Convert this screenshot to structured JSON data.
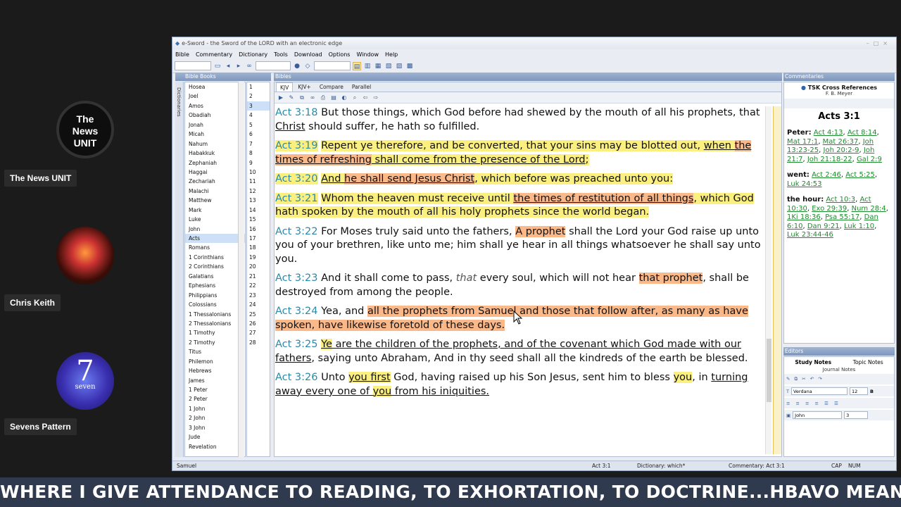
{
  "participants": [
    {
      "name": "The News UNIT",
      "avatar_text": "The\nNews\nUNIT"
    },
    {
      "name": "Chris Keith"
    },
    {
      "name": "Sevens Pattern",
      "avatar_text": "7",
      "avatar_sub": "seven"
    }
  ],
  "window": {
    "title": "e-Sword - the Sword of the LORD with an electronic edge",
    "menu": [
      "Bible",
      "Commentary",
      "Dictionary",
      "Tools",
      "Download",
      "Options",
      "Window",
      "Help"
    ]
  },
  "books_pane": {
    "header": "Bible Books",
    "side_tab": "Dictionaries",
    "books": [
      "Hosea",
      "Joel",
      "Amos",
      "Obadiah",
      "Jonah",
      "Micah",
      "Nahum",
      "Habakkuk",
      "Zephaniah",
      "Haggai",
      "Zechariah",
      "Malachi",
      "Matthew",
      "Mark",
      "Luke",
      "John",
      "Acts",
      "Romans",
      "1 Corinthians",
      "2 Corinthians",
      "Galatians",
      "Ephesians",
      "Philippians",
      "Colossians",
      "1 Thessalonians",
      "2 Thessalonians",
      "1 Timothy",
      "2 Timothy",
      "Titus",
      "Philemon",
      "Hebrews",
      "James",
      "1 Peter",
      "2 Peter",
      "1 John",
      "2 John",
      "3 John",
      "Jude",
      "Revelation"
    ],
    "selected_book": "Acts",
    "chapters": [
      "1",
      "2",
      "3",
      "4",
      "5",
      "6",
      "7",
      "8",
      "9",
      "10",
      "11",
      "12",
      "13",
      "14",
      "15",
      "16",
      "17",
      "18",
      "19",
      "20",
      "21",
      "22",
      "23",
      "24",
      "25",
      "26",
      "27",
      "28"
    ],
    "selected_chapter": "3"
  },
  "bibles_pane": {
    "header": "Bibles",
    "tabs": [
      "KJV",
      "KJV+",
      "Compare",
      "Parallel"
    ],
    "active_tab": "KJV",
    "verses": [
      {
        "ref": "Act 3:18",
        "segments": [
          {
            "t": "But those things, which God before had shewed by the mouth of all his prophets, that "
          },
          {
            "t": "Christ",
            "u": true
          },
          {
            "t": " should suffer, he hath so fulfilled."
          }
        ]
      },
      {
        "ref": "Act 3:19",
        "hl_ref": "y",
        "segments": [
          {
            "t": "Repent ye therefore, and be converted, that your sins may be blotted out, ",
            "h": "y"
          },
          {
            "t": "when ",
            "h": "y",
            "u": true
          },
          {
            "t": "the times of refreshing",
            "h": "o",
            "u": true
          },
          {
            "t": " shall come from the presence of the Lord",
            "h": "y",
            "u": true
          },
          {
            "t": ";",
            "h": "y"
          }
        ]
      },
      {
        "ref": "Act 3:20",
        "hl_ref": "y",
        "segments": [
          {
            "t": "And ",
            "h": "y",
            "u": true
          },
          {
            "t": "he shall send Jesus Christ",
            "h": "o",
            "u": true
          },
          {
            "t": ", which before was preached unto you:",
            "h": "y"
          }
        ]
      },
      {
        "ref": "Act 3:21",
        "hl_ref": "y",
        "segments": [
          {
            "t": "Whom the heaven must receive until ",
            "h": "y"
          },
          {
            "t": "the times of restitution of all things",
            "h": "o",
            "u": true
          },
          {
            "t": ", which God hath spoken by the mouth of all his holy prophets since the world began.",
            "h": "y"
          }
        ]
      },
      {
        "ref": "Act 3:22",
        "segments": [
          {
            "t": "For Moses truly said unto the fathers, "
          },
          {
            "t": "A prophet",
            "h": "o"
          },
          {
            "t": " shall the Lord your God raise up unto you of your brethren, like unto me; him shall ye hear in all things whatsoever he shall say unto you."
          }
        ]
      },
      {
        "ref": "Act 3:23",
        "segments": [
          {
            "t": "And it shall come to pass, "
          },
          {
            "t": "that",
            "i": true
          },
          {
            "t": " every soul, which will not hear "
          },
          {
            "t": "that prophet",
            "h": "o"
          },
          {
            "t": ", shall be destroyed from among the people."
          }
        ]
      },
      {
        "ref": "Act 3:24",
        "segments": [
          {
            "t": "Yea, and "
          },
          {
            "t": "all the prophets from Samuel and those that follow after, as many as have spoken, have likewise foretold of these days.",
            "h": "o"
          }
        ]
      },
      {
        "ref": "Act 3:25",
        "segments": [
          {
            "t": "Ye",
            "h": "y",
            "u": true
          },
          {
            "t": " are the children of the prophets, and of the covenant which God made with our fathers",
            "u": true
          },
          {
            "t": ", saying unto Abraham, And in thy seed shall all the kindreds of the earth be blessed."
          }
        ]
      },
      {
        "ref": "Act 3:26",
        "segments": [
          {
            "t": "Unto "
          },
          {
            "t": "you first",
            "h": "y",
            "u": true
          },
          {
            "t": " God, having raised up his Son Jesus, sent him to bless "
          },
          {
            "t": "you",
            "h": "y"
          },
          {
            "t": ", in "
          },
          {
            "t": "turning away every one of ",
            "u": true
          },
          {
            "t": "you",
            "h": "y",
            "u": true
          },
          {
            "t": " from his iniquities.",
            "u": true
          }
        ]
      }
    ]
  },
  "commentary_pane": {
    "header": "Commentaries",
    "title": "TSK Cross References",
    "subtitle": "F. B. Meyer",
    "verse": "Acts 3:1",
    "groups": [
      {
        "label": "Peter:",
        "refs": [
          "Act 4:13",
          "Act 8:14",
          "Mat 17:1",
          "Mat 26:37",
          "Joh 13:23-25",
          "Joh 20:2-9",
          "Joh 21:7",
          "Joh 21:18-22",
          "Gal 2:9"
        ]
      },
      {
        "label": "went:",
        "refs": [
          "Act 2:46",
          "Act 5:25",
          "Luk 24:53"
        ]
      },
      {
        "label": "the hour:",
        "refs": [
          "Act 10:3",
          "Act 10:30",
          "Exo 29:39",
          "Num 28:4",
          "1Ki 18:36",
          "Psa 55:17",
          "Dan 6:10",
          "Dan 9:21",
          "Luk 1:10",
          "Luk 23:44-46"
        ]
      }
    ]
  },
  "editors_pane": {
    "header": "Editors",
    "tabs": [
      "Study Notes",
      "Topic Notes"
    ],
    "sub_tab": "Journal Notes",
    "font": "Verdana",
    "size": "12",
    "book": "John",
    "chapter": "3"
  },
  "status": {
    "left": "Samuel",
    "bible": "Act 3:1",
    "dictionary": "Dictionary: which*",
    "commentary": "Commentary: Act 3:1",
    "caps": "CAP",
    "num": "NUM"
  },
  "ticker": "WHERE I GIVE ATTENDANCE TO READING, TO EXHORTATION, TO DOCTRINE...HBAVO MEANS HO",
  "colors": {
    "highlight_yellow": "#fbf07f",
    "highlight_orange": "#fbb98a",
    "ref_color": "#2a8aa8",
    "link_green": "#1f8a2e"
  }
}
